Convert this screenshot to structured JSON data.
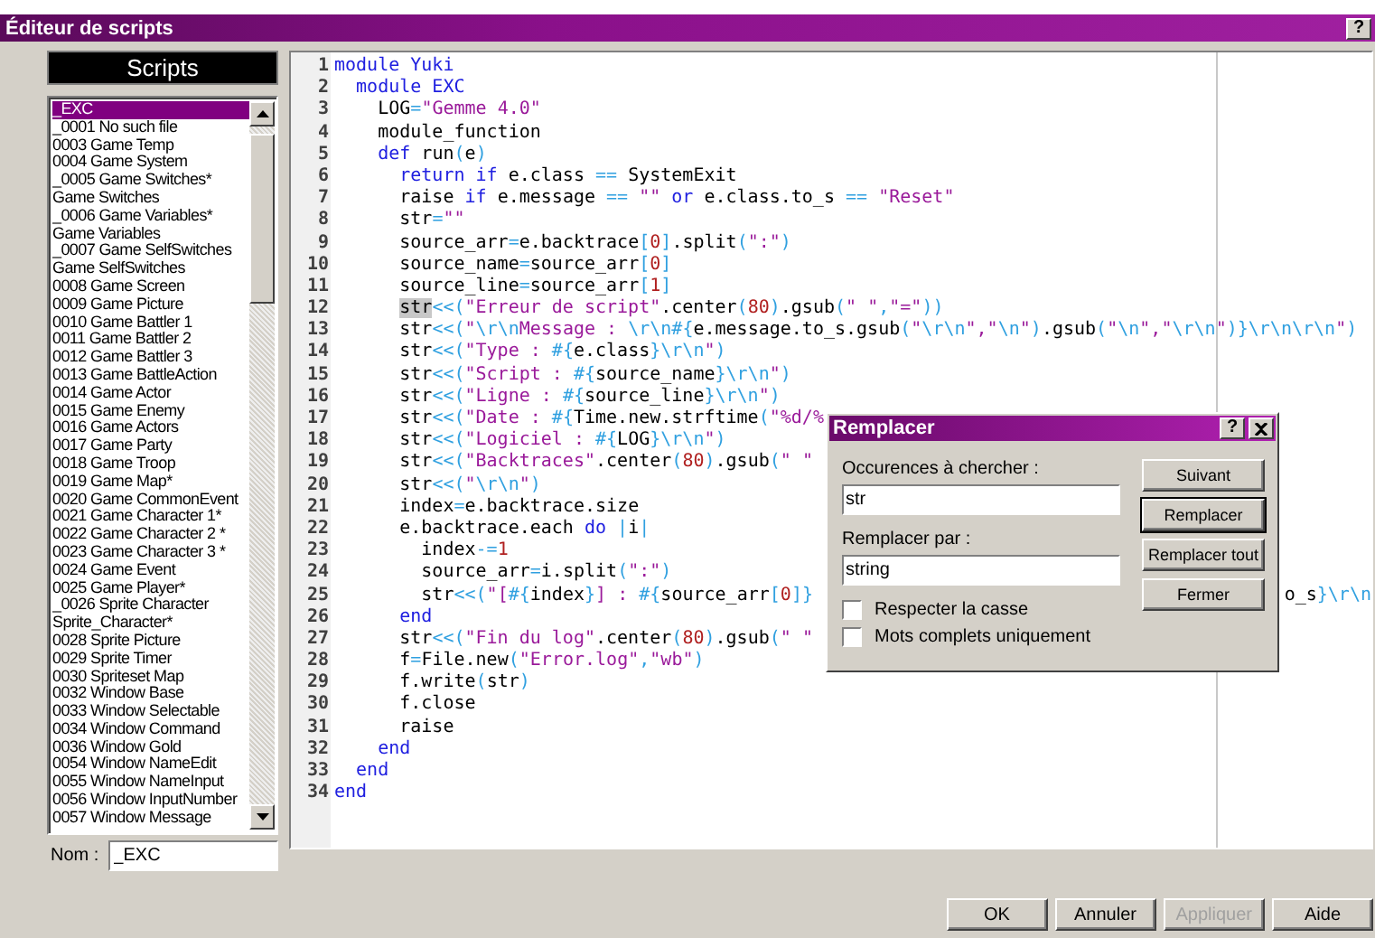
{
  "window": {
    "title": "Éditeur de scripts",
    "help_button": "?"
  },
  "script_list": {
    "header": "Scripts",
    "items": [
      {
        "label": "_EXC",
        "selected": true
      },
      {
        "label": "_0001 No such file",
        "selected": false
      },
      {
        "label": "0003 Game Temp",
        "selected": false
      },
      {
        "label": "0004 Game System",
        "selected": false
      },
      {
        "label": "_0005 Game Switches*",
        "selected": false
      },
      {
        "label": "Game Switches",
        "selected": false
      },
      {
        "label": "_0006 Game Variables*",
        "selected": false
      },
      {
        "label": "Game Variables",
        "selected": false
      },
      {
        "label": "_0007 Game SelfSwitches",
        "selected": false
      },
      {
        "label": "Game SelfSwitches",
        "selected": false
      },
      {
        "label": "0008 Game Screen",
        "selected": false
      },
      {
        "label": "0009 Game Picture",
        "selected": false
      },
      {
        "label": "0010 Game Battler 1",
        "selected": false
      },
      {
        "label": "0011 Game Battler 2",
        "selected": false
      },
      {
        "label": "0012 Game Battler 3",
        "selected": false
      },
      {
        "label": "0013 Game BattleAction",
        "selected": false
      },
      {
        "label": "0014 Game Actor",
        "selected": false
      },
      {
        "label": "0015 Game Enemy",
        "selected": false
      },
      {
        "label": "0016 Game Actors",
        "selected": false
      },
      {
        "label": "0017 Game Party",
        "selected": false
      },
      {
        "label": "0018 Game Troop",
        "selected": false
      },
      {
        "label": "0019 Game Map*",
        "selected": false
      },
      {
        "label": "0020 Game CommonEvent",
        "selected": false
      },
      {
        "label": "0021 Game Character 1*",
        "selected": false
      },
      {
        "label": "0022 Game Character 2 *",
        "selected": false
      },
      {
        "label": "0023 Game Character 3 *",
        "selected": false
      },
      {
        "label": "0024 Game Event",
        "selected": false
      },
      {
        "label": "0025 Game Player*",
        "selected": false
      },
      {
        "label": "_0026 Sprite Character",
        "selected": false
      },
      {
        "label": "Sprite_Character*",
        "selected": false
      },
      {
        "label": "0028 Sprite Picture",
        "selected": false
      },
      {
        "label": "0029 Sprite Timer",
        "selected": false
      },
      {
        "label": "0030 Spriteset Map",
        "selected": false
      },
      {
        "label": "0032 Window Base",
        "selected": false
      },
      {
        "label": "0033 Window Selectable",
        "selected": false
      },
      {
        "label": "0034 Window Command",
        "selected": false
      },
      {
        "label": "0036 Window Gold",
        "selected": false
      },
      {
        "label": "0054 Window NameEdit",
        "selected": false
      },
      {
        "label": "0055 Window NameInput",
        "selected": false
      },
      {
        "label": "0056 Window InputNumber",
        "selected": false
      },
      {
        "label": "0057 Window Message",
        "selected": false
      }
    ]
  },
  "name_field": {
    "label": "Nom :",
    "value": "_EXC"
  },
  "editor": {
    "lines": [
      {
        "number": "1",
        "tokens": [
          {
            "kind": "kw",
            "text": "module Yuki"
          }
        ]
      },
      {
        "number": "2",
        "tokens": [
          {
            "kind": "kw",
            "text": "  module EXC"
          }
        ]
      },
      {
        "number": "3",
        "tokens": [
          {
            "kind": "id",
            "text": "    LOG"
          },
          {
            "kind": "op",
            "text": "="
          },
          {
            "kind": "str",
            "text": "\"Gemme 4.0\""
          }
        ]
      },
      {
        "number": "4",
        "tokens": [
          {
            "kind": "id",
            "text": "    module_function"
          }
        ]
      },
      {
        "number": "5",
        "tokens": [
          {
            "kind": "kw",
            "text": "    def"
          },
          {
            "kind": "id",
            "text": " run"
          },
          {
            "kind": "op",
            "text": "("
          },
          {
            "kind": "id",
            "text": "e"
          },
          {
            "kind": "op",
            "text": ")"
          }
        ]
      },
      {
        "number": "6",
        "tokens": [
          {
            "kind": "kw",
            "text": "      return if"
          },
          {
            "kind": "id",
            "text": " e.class "
          },
          {
            "kind": "op",
            "text": "=="
          },
          {
            "kind": "id",
            "text": " SystemExit"
          }
        ]
      },
      {
        "number": "7",
        "tokens": [
          {
            "kind": "id",
            "text": "      raise "
          },
          {
            "kind": "kw",
            "text": "if"
          },
          {
            "kind": "id",
            "text": " e.message "
          },
          {
            "kind": "op",
            "text": "=="
          },
          {
            "kind": "str",
            "text": " \"\""
          },
          {
            "kind": "kw",
            "text": " or"
          },
          {
            "kind": "id",
            "text": " e.class.to_s "
          },
          {
            "kind": "op",
            "text": "=="
          },
          {
            "kind": "str",
            "text": " \"Reset\""
          }
        ]
      },
      {
        "number": "8",
        "tokens": [
          {
            "kind": "id",
            "text": "      str"
          },
          {
            "kind": "op",
            "text": "="
          },
          {
            "kind": "str",
            "text": "\"\""
          }
        ]
      },
      {
        "number": "9",
        "tokens": [
          {
            "kind": "id",
            "text": "      source_arr"
          },
          {
            "kind": "op",
            "text": "="
          },
          {
            "kind": "id",
            "text": "e.backtrace"
          },
          {
            "kind": "op",
            "text": "["
          },
          {
            "kind": "num",
            "text": "0"
          },
          {
            "kind": "op",
            "text": "]"
          },
          {
            "kind": "id",
            "text": ".split"
          },
          {
            "kind": "op",
            "text": "("
          },
          {
            "kind": "str",
            "text": "\":\""
          },
          {
            "kind": "op",
            "text": ")"
          }
        ]
      },
      {
        "number": "10",
        "tokens": [
          {
            "kind": "id",
            "text": "      source_name"
          },
          {
            "kind": "op",
            "text": "="
          },
          {
            "kind": "id",
            "text": "source_arr"
          },
          {
            "kind": "op",
            "text": "["
          },
          {
            "kind": "num",
            "text": "0"
          },
          {
            "kind": "op",
            "text": "]"
          }
        ]
      },
      {
        "number": "11",
        "tokens": [
          {
            "kind": "id",
            "text": "      source_line"
          },
          {
            "kind": "op",
            "text": "="
          },
          {
            "kind": "id",
            "text": "source_arr"
          },
          {
            "kind": "op",
            "text": "["
          },
          {
            "kind": "num",
            "text": "1"
          },
          {
            "kind": "op",
            "text": "]"
          }
        ]
      },
      {
        "number": "12",
        "tokens": [
          {
            "kind": "hl",
            "text": "      str"
          },
          {
            "kind": "op",
            "text": "<<("
          },
          {
            "kind": "str",
            "text": "\"Erreur de script\""
          },
          {
            "kind": "id",
            "text": ".center"
          },
          {
            "kind": "op",
            "text": "("
          },
          {
            "kind": "num",
            "text": "80"
          },
          {
            "kind": "op",
            "text": ")"
          },
          {
            "kind": "id",
            "text": ".gsub"
          },
          {
            "kind": "op",
            "text": "("
          },
          {
            "kind": "str",
            "text": "\" \""
          },
          {
            "kind": "op",
            "text": ","
          },
          {
            "kind": "str",
            "text": "\"=\""
          },
          {
            "kind": "op",
            "text": "))"
          }
        ]
      },
      {
        "number": "13",
        "tokens": [
          {
            "kind": "id",
            "text": "      str"
          },
          {
            "kind": "op",
            "text": "<<("
          },
          {
            "kind": "str",
            "text": "\""
          },
          {
            "kind": "op",
            "text": "\\r\\n"
          },
          {
            "kind": "str",
            "text": "Message : "
          },
          {
            "kind": "op",
            "text": "\\r\\n#{"
          },
          {
            "kind": "id",
            "text": "e.message.to_s.gsub"
          },
          {
            "kind": "op",
            "text": "("
          },
          {
            "kind": "str",
            "text": "\""
          },
          {
            "kind": "op",
            "text": "\\r\\n"
          },
          {
            "kind": "str",
            "text": "\",\""
          },
          {
            "kind": "op",
            "text": "\\n"
          },
          {
            "kind": "str",
            "text": "\""
          },
          {
            "kind": "op",
            "text": ")"
          },
          {
            "kind": "id",
            "text": ".gsub"
          },
          {
            "kind": "op",
            "text": "("
          },
          {
            "kind": "str",
            "text": "\""
          },
          {
            "kind": "op",
            "text": "\\n"
          },
          {
            "kind": "str",
            "text": "\",\""
          },
          {
            "kind": "op",
            "text": "\\r\\n"
          },
          {
            "kind": "str",
            "text": "\""
          },
          {
            "kind": "op",
            "text": ")}\\r\\n\\r\\n"
          },
          {
            "kind": "str",
            "text": "\""
          },
          {
            "kind": "op",
            "text": ")"
          }
        ]
      },
      {
        "number": "14",
        "tokens": [
          {
            "kind": "id",
            "text": "      str"
          },
          {
            "kind": "op",
            "text": "<<("
          },
          {
            "kind": "str",
            "text": "\"Type : "
          },
          {
            "kind": "op",
            "text": "#{"
          },
          {
            "kind": "id",
            "text": "e.class"
          },
          {
            "kind": "op",
            "text": "}\\r\\n"
          },
          {
            "kind": "str",
            "text": "\""
          },
          {
            "kind": "op",
            "text": ")"
          }
        ]
      },
      {
        "number": "15",
        "tokens": [
          {
            "kind": "id",
            "text": "      str"
          },
          {
            "kind": "op",
            "text": "<<("
          },
          {
            "kind": "str",
            "text": "\"Script : "
          },
          {
            "kind": "op",
            "text": "#{"
          },
          {
            "kind": "id",
            "text": "source_name"
          },
          {
            "kind": "op",
            "text": "}\\r\\n"
          },
          {
            "kind": "str",
            "text": "\""
          },
          {
            "kind": "op",
            "text": ")"
          }
        ]
      },
      {
        "number": "16",
        "tokens": [
          {
            "kind": "id",
            "text": "      str"
          },
          {
            "kind": "op",
            "text": "<<("
          },
          {
            "kind": "str",
            "text": "\"Ligne : "
          },
          {
            "kind": "op",
            "text": "#{"
          },
          {
            "kind": "id",
            "text": "source_line"
          },
          {
            "kind": "op",
            "text": "}\\r\\n"
          },
          {
            "kind": "str",
            "text": "\""
          },
          {
            "kind": "op",
            "text": ")"
          }
        ]
      },
      {
        "number": "17",
        "tokens": [
          {
            "kind": "id",
            "text": "      str"
          },
          {
            "kind": "op",
            "text": "<<("
          },
          {
            "kind": "str",
            "text": "\"Date : "
          },
          {
            "kind": "op",
            "text": "#{"
          },
          {
            "kind": "id",
            "text": "Time.new.strftime"
          },
          {
            "kind": "op",
            "text": "("
          },
          {
            "kind": "str",
            "text": "\"%d/%"
          }
        ]
      },
      {
        "number": "18",
        "tokens": [
          {
            "kind": "id",
            "text": "      str"
          },
          {
            "kind": "op",
            "text": "<<("
          },
          {
            "kind": "str",
            "text": "\"Logiciel : "
          },
          {
            "kind": "op",
            "text": "#{"
          },
          {
            "kind": "id",
            "text": "LOG"
          },
          {
            "kind": "op",
            "text": "}\\r\\n"
          },
          {
            "kind": "str",
            "text": "\""
          },
          {
            "kind": "op",
            "text": ")"
          }
        ]
      },
      {
        "number": "19",
        "tokens": [
          {
            "kind": "id",
            "text": "      str"
          },
          {
            "kind": "op",
            "text": "<<("
          },
          {
            "kind": "str",
            "text": "\"Backtraces\""
          },
          {
            "kind": "id",
            "text": ".center"
          },
          {
            "kind": "op",
            "text": "("
          },
          {
            "kind": "num",
            "text": "80"
          },
          {
            "kind": "op",
            "text": ")"
          },
          {
            "kind": "id",
            "text": ".gsub"
          },
          {
            "kind": "op",
            "text": "("
          },
          {
            "kind": "str",
            "text": "\" \""
          }
        ]
      },
      {
        "number": "20",
        "tokens": [
          {
            "kind": "id",
            "text": "      str"
          },
          {
            "kind": "op",
            "text": "<<("
          },
          {
            "kind": "str",
            "text": "\""
          },
          {
            "kind": "op",
            "text": "\\r\\n"
          },
          {
            "kind": "str",
            "text": "\""
          },
          {
            "kind": "op",
            "text": ")"
          }
        ]
      },
      {
        "number": "21",
        "tokens": [
          {
            "kind": "id",
            "text": "      index"
          },
          {
            "kind": "op",
            "text": "="
          },
          {
            "kind": "id",
            "text": "e.backtrace.size"
          }
        ]
      },
      {
        "number": "22",
        "tokens": [
          {
            "kind": "id",
            "text": "      e.backtrace.each "
          },
          {
            "kind": "kw",
            "text": "do"
          },
          {
            "kind": "op",
            "text": " |"
          },
          {
            "kind": "id",
            "text": "i"
          },
          {
            "kind": "op",
            "text": "|"
          }
        ]
      },
      {
        "number": "23",
        "tokens": [
          {
            "kind": "id",
            "text": "        index"
          },
          {
            "kind": "op",
            "text": "-="
          },
          {
            "kind": "num",
            "text": "1"
          }
        ]
      },
      {
        "number": "24",
        "tokens": [
          {
            "kind": "id",
            "text": "        source_arr"
          },
          {
            "kind": "op",
            "text": "="
          },
          {
            "kind": "id",
            "text": "i.split"
          },
          {
            "kind": "op",
            "text": "("
          },
          {
            "kind": "str",
            "text": "\":\""
          },
          {
            "kind": "op",
            "text": ")"
          }
        ]
      },
      {
        "number": "25",
        "tokens": [
          {
            "kind": "id",
            "text": "        str"
          },
          {
            "kind": "op",
            "text": "<<("
          },
          {
            "kind": "str",
            "text": "\"["
          },
          {
            "kind": "op",
            "text": "#{"
          },
          {
            "kind": "id",
            "text": "index"
          },
          {
            "kind": "op",
            "text": "}"
          },
          {
            "kind": "str",
            "text": "] : "
          },
          {
            "kind": "op",
            "text": "#{"
          },
          {
            "kind": "id",
            "text": "source_arr"
          },
          {
            "kind": "op",
            "text": "["
          },
          {
            "kind": "num",
            "text": "0"
          },
          {
            "kind": "op",
            "text": "]}"
          }
        ],
        "tokens_after": [
          {
            "kind": "id",
            "text": "o_s"
          },
          {
            "kind": "op",
            "text": "}\\r\\n"
          }
        ]
      },
      {
        "number": "26",
        "tokens": [
          {
            "kind": "kw",
            "text": "      end"
          }
        ]
      },
      {
        "number": "27",
        "tokens": [
          {
            "kind": "id",
            "text": "      str"
          },
          {
            "kind": "op",
            "text": "<<("
          },
          {
            "kind": "str",
            "text": "\"Fin du log\""
          },
          {
            "kind": "id",
            "text": ".center"
          },
          {
            "kind": "op",
            "text": "("
          },
          {
            "kind": "num",
            "text": "80"
          },
          {
            "kind": "op",
            "text": ")"
          },
          {
            "kind": "id",
            "text": ".gsub"
          },
          {
            "kind": "op",
            "text": "("
          },
          {
            "kind": "str",
            "text": "\" \""
          }
        ]
      },
      {
        "number": "28",
        "tokens": [
          {
            "kind": "id",
            "text": "      f"
          },
          {
            "kind": "op",
            "text": "="
          },
          {
            "kind": "id",
            "text": "File.new"
          },
          {
            "kind": "op",
            "text": "("
          },
          {
            "kind": "str",
            "text": "\"Error.log\""
          },
          {
            "kind": "op",
            "text": ","
          },
          {
            "kind": "str",
            "text": "\"wb\""
          },
          {
            "kind": "op",
            "text": ")"
          }
        ]
      },
      {
        "number": "29",
        "tokens": [
          {
            "kind": "id",
            "text": "      f.write"
          },
          {
            "kind": "op",
            "text": "("
          },
          {
            "kind": "id",
            "text": "str"
          },
          {
            "kind": "op",
            "text": ")"
          }
        ]
      },
      {
        "number": "30",
        "tokens": [
          {
            "kind": "id",
            "text": "      f.close"
          }
        ]
      },
      {
        "number": "31",
        "tokens": [
          {
            "kind": "id",
            "text": "      raise"
          }
        ]
      },
      {
        "number": "32",
        "tokens": [
          {
            "kind": "kw",
            "text": "    end"
          }
        ]
      },
      {
        "number": "33",
        "tokens": [
          {
            "kind": "kw",
            "text": "  end"
          }
        ]
      },
      {
        "number": "34",
        "tokens": [
          {
            "kind": "kw",
            "text": "end"
          }
        ]
      }
    ]
  },
  "replace_dialog": {
    "title": "Remplacer",
    "help_button": "?",
    "find_label": "Occurences à chercher :",
    "find_value": "str",
    "replace_label": "Remplacer par :",
    "replace_value": "string",
    "options": [
      {
        "label": "Respecter la casse",
        "checked": false
      },
      {
        "label": "Mots complets uniquement",
        "checked": false
      }
    ],
    "buttons": [
      {
        "label": "Suivant",
        "default": false
      },
      {
        "label": "Remplacer",
        "default": true
      },
      {
        "label": "Remplacer tout",
        "default": false
      },
      {
        "label": "Fermer",
        "default": false
      }
    ]
  },
  "buttons": [
    {
      "label": "OK",
      "disabled": false
    },
    {
      "label": "Annuler",
      "disabled": false
    },
    {
      "label": "Appliquer",
      "disabled": true
    },
    {
      "label": "Aide",
      "disabled": false
    }
  ]
}
